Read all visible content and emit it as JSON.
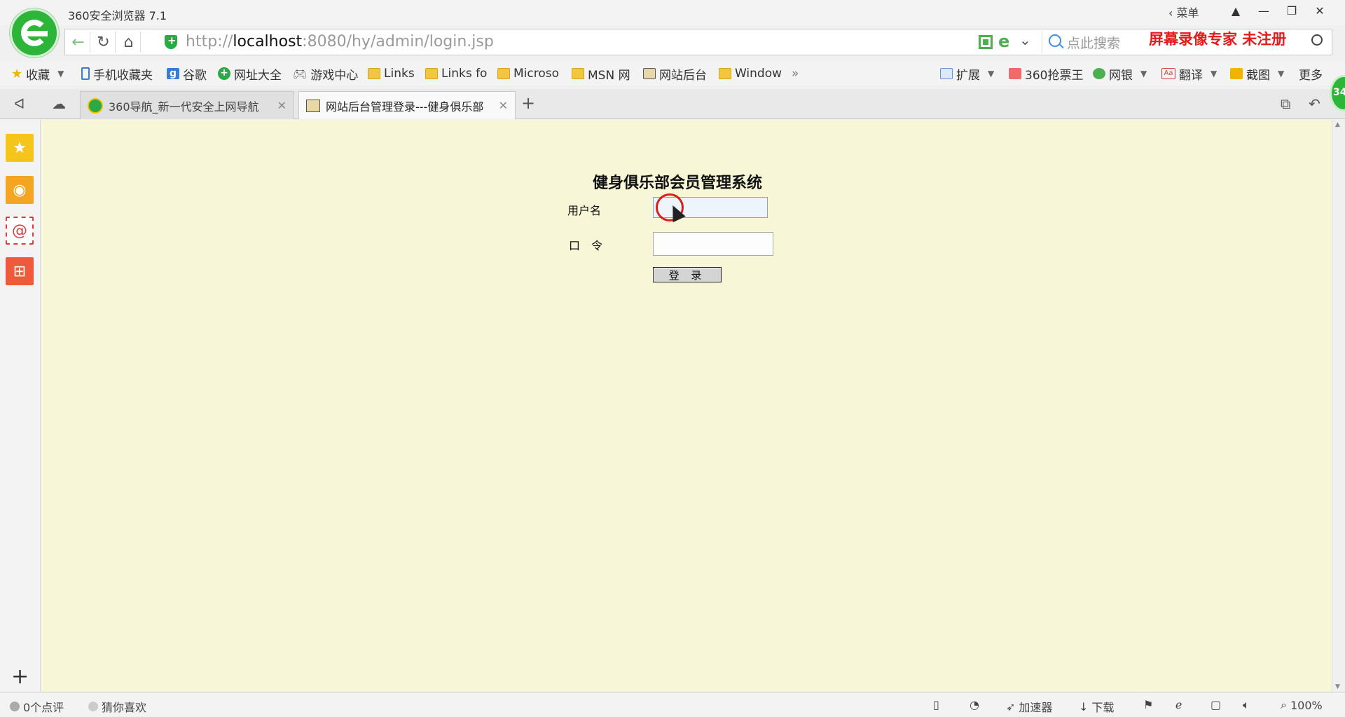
{
  "browser": {
    "title": "360安全浏览器 7.1",
    "menu_label": "菜单",
    "url_prefix": "http://",
    "url_host": "localhost",
    "url_rest": ":8080/hy/admin/login.jsp",
    "search_placeholder": "点此搜索",
    "watermark": "屏幕录像专家  未注册",
    "corner_badge": "34"
  },
  "bookmarks": [
    {
      "label": "收藏",
      "icon": "star-icon"
    },
    {
      "label": "手机收藏夹",
      "icon": "phone-icon"
    },
    {
      "label": "谷歌",
      "icon": "google-icon"
    },
    {
      "label": "网址大全",
      "icon": "360-plus-icon"
    },
    {
      "label": "游戏中心",
      "icon": "gamepad-icon"
    },
    {
      "label": "Links",
      "icon": "folder-icon"
    },
    {
      "label": "Links fo",
      "icon": "folder-icon"
    },
    {
      "label": "Microso",
      "icon": "folder-icon"
    },
    {
      "label": "MSN 网",
      "icon": "folder-icon"
    },
    {
      "label": "网站后台",
      "icon": "site-icon"
    },
    {
      "label": "Window",
      "icon": "folder-icon"
    }
  ],
  "toolbar_right": [
    {
      "label": "扩展",
      "icon": "extension-icon"
    },
    {
      "label": "360抢票王",
      "icon": "ticket-icon"
    },
    {
      "label": "网银",
      "icon": "bank-icon"
    },
    {
      "label": "翻译",
      "icon": "translate-icon"
    },
    {
      "label": "截图",
      "icon": "screenshot-icon"
    },
    {
      "label": "更多",
      "icon": "more-icon"
    }
  ],
  "tabs": [
    {
      "label": "360导航_新一代安全上网导航",
      "active": false
    },
    {
      "label": "网站后台管理登录---健身俱乐部",
      "active": true
    }
  ],
  "page": {
    "title": "健身俱乐部会员管理系统",
    "username_label": "用户名",
    "password_label": "口　令",
    "username_value": "",
    "password_value": "",
    "login_button": "登 录"
  },
  "statusbar": {
    "comments": "0个点评",
    "guess": "猜你喜欢",
    "accelerator": "加速器",
    "download": "下载",
    "zoom": "100%"
  }
}
